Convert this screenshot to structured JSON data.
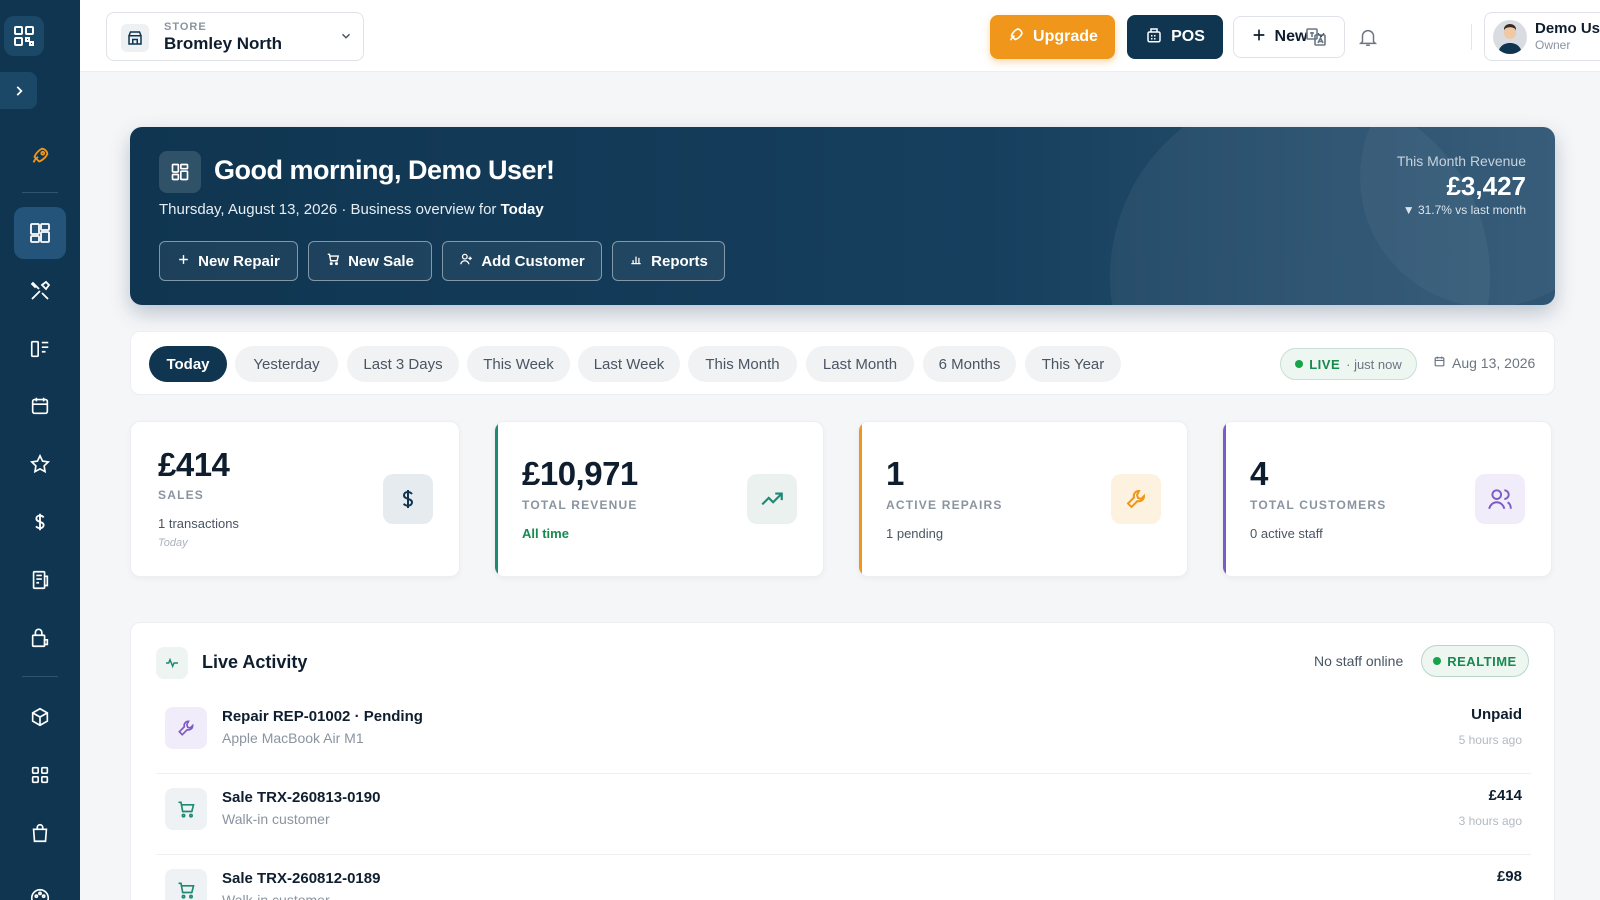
{
  "colors": {
    "sidebar": "#0f3550",
    "brand_dark": "#0f3550",
    "upgrade": "#f0961a",
    "live_green": "#16a34a",
    "card_revenue_accent": "#1f8a73",
    "card_repairs_accent": "#f0961a",
    "card_customers_accent": "#7c5cc4"
  },
  "sidebar": {
    "items": [
      {
        "name": "logo-icon"
      },
      {
        "name": "expand-icon"
      },
      {
        "name": "rocket-icon"
      },
      {
        "name": "dashboard-icon"
      },
      {
        "name": "tools-icon"
      },
      {
        "name": "tasks-icon"
      },
      {
        "name": "calendar-icon"
      },
      {
        "name": "star-icon"
      },
      {
        "name": "dollar-icon"
      },
      {
        "name": "receipt-icon"
      },
      {
        "name": "shop-lock-icon"
      },
      {
        "name": "box-icon"
      },
      {
        "name": "grid-icon"
      },
      {
        "name": "bag-icon"
      },
      {
        "name": "palette-icon"
      }
    ]
  },
  "header": {
    "store_caption": "STORE",
    "store_name": "Bromley North",
    "upgrade_label": "Upgrade",
    "pos_label": "POS",
    "new_label": "New",
    "user_name": "Demo User",
    "user_role": "Owner"
  },
  "hero": {
    "greeting": "Good morning, Demo User!",
    "date_text": "Thursday, August 13, 2026",
    "overview_prefix": "Business overview for",
    "overview_period": "Today",
    "actions": [
      {
        "label": "New Repair",
        "icon": "plus-icon"
      },
      {
        "label": "New Sale",
        "icon": "cart-icon"
      },
      {
        "label": "Add Customer",
        "icon": "user-add-icon"
      },
      {
        "label": "Reports",
        "icon": "bar-chart-icon"
      }
    ],
    "revenue_label": "This Month Revenue",
    "revenue_value": "£3,427",
    "revenue_delta": "▼ 31.7% vs last month"
  },
  "filters": {
    "chips": [
      "Today",
      "Yesterday",
      "Last 3 Days",
      "This Week",
      "Last Week",
      "This Month",
      "Last Month",
      "6 Months",
      "This Year"
    ],
    "active": "Today",
    "live_label": "LIVE",
    "live_time": "· just now",
    "date": "Aug 13, 2026"
  },
  "stats": {
    "sales": {
      "value": "£414",
      "label": "SALES",
      "note": "1 transactions",
      "sub": "Today"
    },
    "revenue": {
      "value": "£10,971",
      "label": "TOTAL REVENUE",
      "note": "All time"
    },
    "repairs": {
      "value": "1",
      "label": "ACTIVE REPAIRS",
      "note": "1 pending"
    },
    "customers": {
      "value": "4",
      "label": "TOTAL CUSTOMERS",
      "note": "0 active staff"
    }
  },
  "activity": {
    "title": "Live Activity",
    "staff_status": "No staff online",
    "realtime_label": "REALTIME",
    "rows": [
      {
        "title": "Repair REP-01002 · Pending",
        "subtitle": "Apple MacBook Air M1",
        "right": "Unpaid",
        "time": "5 hours ago",
        "icon": "wrench-icon"
      },
      {
        "title": "Sale TRX-260813-0190",
        "subtitle": "Walk-in customer",
        "right": "£414",
        "time": "3 hours ago",
        "icon": "cart-icon"
      },
      {
        "title": "Sale TRX-260812-0189",
        "subtitle": "Walk-in customer",
        "right": "£98",
        "time": "",
        "icon": "cart-icon"
      }
    ]
  }
}
